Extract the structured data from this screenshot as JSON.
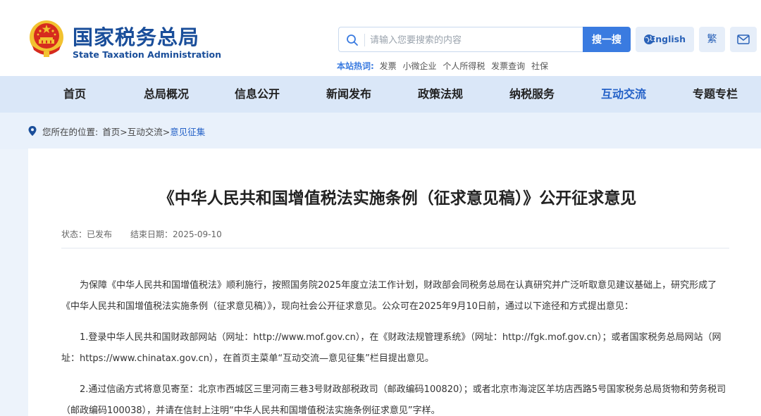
{
  "header": {
    "title_cn": "国家税务总局",
    "title_en": "State Taxation Administration",
    "search": {
      "placeholder": "请输入您要搜索的内容",
      "button_label": "搜一搜"
    },
    "lang_label": "English",
    "trad_label": "繁",
    "hot_words": {
      "label": "本站热词:",
      "items": [
        "发票",
        "小微企业",
        "个人所得税",
        "发票查询",
        "社保"
      ]
    }
  },
  "nav": {
    "items": [
      {
        "label": "首页"
      },
      {
        "label": "总局概况"
      },
      {
        "label": "信息公开"
      },
      {
        "label": "新闻发布"
      },
      {
        "label": "政策法规"
      },
      {
        "label": "纳税服务"
      },
      {
        "label": "互动交流",
        "active": true
      },
      {
        "label": "专题专栏"
      }
    ]
  },
  "breadcrumb": {
    "label": "您所在的位置:",
    "items": [
      "首页",
      "互动交流",
      "意见征集"
    ],
    "separator": ">"
  },
  "article": {
    "title": "《中华人民共和国增值税法实施条例（征求意见稿）》公开征求意见",
    "status_label": "状态：",
    "status_value": "已发布",
    "end_date_label": "结束日期：",
    "end_date_value": "2025-09-10",
    "paragraphs": [
      "为保障《中华人民共和国增值税法》顺利施行，按照国务院2025年度立法工作计划，财政部会同税务总局在认真研究并广泛听取意见建议基础上，研究形成了《中华人民共和国增值税法实施条例（征求意见稿）》，现向社会公开征求意见。公众可在2025年9月10日前，通过以下途径和方式提出意见：",
      "1.登录中华人民共和国财政部网站（网址：http://www.mof.gov.cn），在《财政法规管理系统》（网址：http://fgk.mof.gov.cn）；或者国家税务总局网站（网址：https://www.chinatax.gov.cn），在首页主菜单“互动交流—意见征集”栏目提出意见。",
      "2.通过信函方式将意见寄至：北京市西城区三里河南三巷3号财政部税政司（邮政编码100820）；或者北京市海淀区羊坊店西路5号国家税务总局货物和劳务税司（邮政编码100038），并请在信封上注明“中华人民共和国增值税法实施条例征求意见”字样。"
    ]
  },
  "colors": {
    "brand_blue": "#1a4e9a",
    "accent_blue": "#3a7be0",
    "nav_bg": "#dae7f8",
    "emblem_red": "#d62b1e",
    "emblem_gold": "#f2c230"
  },
  "icons": [
    "national-emblem-icon",
    "search-icon",
    "globe-icon",
    "mail-icon",
    "location-pin-icon"
  ]
}
